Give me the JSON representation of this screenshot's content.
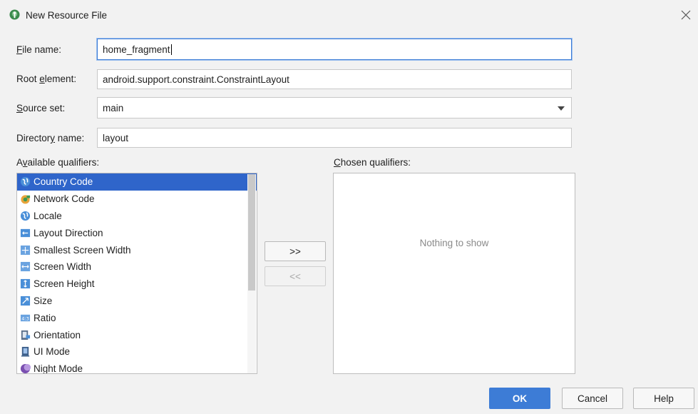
{
  "window": {
    "title": "New Resource File",
    "close_icon": "close-icon"
  },
  "form": {
    "file_name": {
      "label_mn": "F",
      "label_rest": "ile name:",
      "value": "home_fragment"
    },
    "root_element": {
      "label_pre": "Root ",
      "label_mn": "e",
      "label_rest": "lement:",
      "value": "android.support.constraint.ConstraintLayout"
    },
    "source_set": {
      "label_mn": "S",
      "label_rest": "ource set:",
      "value": "main"
    },
    "directory_name": {
      "label_pre": "Director",
      "label_mn": "y",
      "label_rest": " name:",
      "value": "layout"
    }
  },
  "available": {
    "label_pre": "A",
    "label_mn": "v",
    "label_rest": "ailable qualifiers:",
    "items": [
      {
        "label": "Country Code",
        "icon": "globe-icon",
        "selected": true
      },
      {
        "label": "Network Code",
        "icon": "network-icon"
      },
      {
        "label": "Locale",
        "icon": "globe-icon"
      },
      {
        "label": "Layout Direction",
        "icon": "layout-direction-icon"
      },
      {
        "label": "Smallest Screen Width",
        "icon": "smallest-width-icon"
      },
      {
        "label": "Screen Width",
        "icon": "screen-width-icon"
      },
      {
        "label": "Screen Height",
        "icon": "screen-height-icon"
      },
      {
        "label": "Size",
        "icon": "size-icon"
      },
      {
        "label": "Ratio",
        "icon": "ratio-icon"
      },
      {
        "label": "Orientation",
        "icon": "orientation-icon"
      },
      {
        "label": "UI Mode",
        "icon": "ui-mode-icon"
      },
      {
        "label": "Night Mode",
        "icon": "night-mode-icon"
      }
    ]
  },
  "chosen": {
    "label_mn": "C",
    "label_rest": "hosen qualifiers:",
    "empty_text": "Nothing to show"
  },
  "transfer": {
    "add_label": ">>",
    "remove_label": "<<"
  },
  "footer": {
    "ok_label": "OK",
    "cancel_label": "Cancel",
    "help_label": "Help"
  },
  "colors": {
    "accent": "#3d7cd6",
    "selection": "#2f65ca",
    "background": "#f2f2f2"
  }
}
